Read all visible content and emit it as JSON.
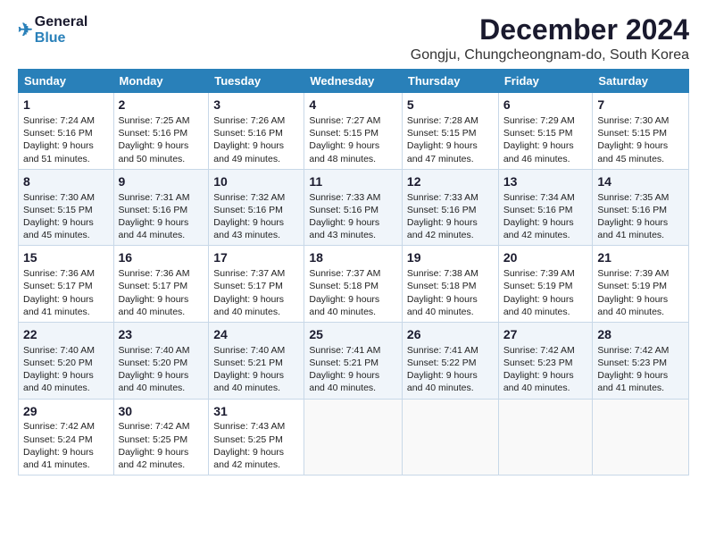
{
  "logo": {
    "line1": "General",
    "line2": "Blue"
  },
  "title": "December 2024",
  "subtitle": "Gongju, Chungcheongnam-do, South Korea",
  "days_of_week": [
    "Sunday",
    "Monday",
    "Tuesday",
    "Wednesday",
    "Thursday",
    "Friday",
    "Saturday"
  ],
  "weeks": [
    [
      {
        "day": "1",
        "info": "Sunrise: 7:24 AM\nSunset: 5:16 PM\nDaylight: 9 hours and 51 minutes."
      },
      {
        "day": "2",
        "info": "Sunrise: 7:25 AM\nSunset: 5:16 PM\nDaylight: 9 hours and 50 minutes."
      },
      {
        "day": "3",
        "info": "Sunrise: 7:26 AM\nSunset: 5:16 PM\nDaylight: 9 hours and 49 minutes."
      },
      {
        "day": "4",
        "info": "Sunrise: 7:27 AM\nSunset: 5:15 PM\nDaylight: 9 hours and 48 minutes."
      },
      {
        "day": "5",
        "info": "Sunrise: 7:28 AM\nSunset: 5:15 PM\nDaylight: 9 hours and 47 minutes."
      },
      {
        "day": "6",
        "info": "Sunrise: 7:29 AM\nSunset: 5:15 PM\nDaylight: 9 hours and 46 minutes."
      },
      {
        "day": "7",
        "info": "Sunrise: 7:30 AM\nSunset: 5:15 PM\nDaylight: 9 hours and 45 minutes."
      }
    ],
    [
      {
        "day": "8",
        "info": "Sunrise: 7:30 AM\nSunset: 5:15 PM\nDaylight: 9 hours and 45 minutes."
      },
      {
        "day": "9",
        "info": "Sunrise: 7:31 AM\nSunset: 5:16 PM\nDaylight: 9 hours and 44 minutes."
      },
      {
        "day": "10",
        "info": "Sunrise: 7:32 AM\nSunset: 5:16 PM\nDaylight: 9 hours and 43 minutes."
      },
      {
        "day": "11",
        "info": "Sunrise: 7:33 AM\nSunset: 5:16 PM\nDaylight: 9 hours and 43 minutes."
      },
      {
        "day": "12",
        "info": "Sunrise: 7:33 AM\nSunset: 5:16 PM\nDaylight: 9 hours and 42 minutes."
      },
      {
        "day": "13",
        "info": "Sunrise: 7:34 AM\nSunset: 5:16 PM\nDaylight: 9 hours and 42 minutes."
      },
      {
        "day": "14",
        "info": "Sunrise: 7:35 AM\nSunset: 5:16 PM\nDaylight: 9 hours and 41 minutes."
      }
    ],
    [
      {
        "day": "15",
        "info": "Sunrise: 7:36 AM\nSunset: 5:17 PM\nDaylight: 9 hours and 41 minutes."
      },
      {
        "day": "16",
        "info": "Sunrise: 7:36 AM\nSunset: 5:17 PM\nDaylight: 9 hours and 40 minutes."
      },
      {
        "day": "17",
        "info": "Sunrise: 7:37 AM\nSunset: 5:17 PM\nDaylight: 9 hours and 40 minutes."
      },
      {
        "day": "18",
        "info": "Sunrise: 7:37 AM\nSunset: 5:18 PM\nDaylight: 9 hours and 40 minutes."
      },
      {
        "day": "19",
        "info": "Sunrise: 7:38 AM\nSunset: 5:18 PM\nDaylight: 9 hours and 40 minutes."
      },
      {
        "day": "20",
        "info": "Sunrise: 7:39 AM\nSunset: 5:19 PM\nDaylight: 9 hours and 40 minutes."
      },
      {
        "day": "21",
        "info": "Sunrise: 7:39 AM\nSunset: 5:19 PM\nDaylight: 9 hours and 40 minutes."
      }
    ],
    [
      {
        "day": "22",
        "info": "Sunrise: 7:40 AM\nSunset: 5:20 PM\nDaylight: 9 hours and 40 minutes."
      },
      {
        "day": "23",
        "info": "Sunrise: 7:40 AM\nSunset: 5:20 PM\nDaylight: 9 hours and 40 minutes."
      },
      {
        "day": "24",
        "info": "Sunrise: 7:40 AM\nSunset: 5:21 PM\nDaylight: 9 hours and 40 minutes."
      },
      {
        "day": "25",
        "info": "Sunrise: 7:41 AM\nSunset: 5:21 PM\nDaylight: 9 hours and 40 minutes."
      },
      {
        "day": "26",
        "info": "Sunrise: 7:41 AM\nSunset: 5:22 PM\nDaylight: 9 hours and 40 minutes."
      },
      {
        "day": "27",
        "info": "Sunrise: 7:42 AM\nSunset: 5:23 PM\nDaylight: 9 hours and 40 minutes."
      },
      {
        "day": "28",
        "info": "Sunrise: 7:42 AM\nSunset: 5:23 PM\nDaylight: 9 hours and 41 minutes."
      }
    ],
    [
      {
        "day": "29",
        "info": "Sunrise: 7:42 AM\nSunset: 5:24 PM\nDaylight: 9 hours and 41 minutes."
      },
      {
        "day": "30",
        "info": "Sunrise: 7:42 AM\nSunset: 5:25 PM\nDaylight: 9 hours and 42 minutes."
      },
      {
        "day": "31",
        "info": "Sunrise: 7:43 AM\nSunset: 5:25 PM\nDaylight: 9 hours and 42 minutes."
      },
      {
        "day": "",
        "info": ""
      },
      {
        "day": "",
        "info": ""
      },
      {
        "day": "",
        "info": ""
      },
      {
        "day": "",
        "info": ""
      }
    ]
  ]
}
